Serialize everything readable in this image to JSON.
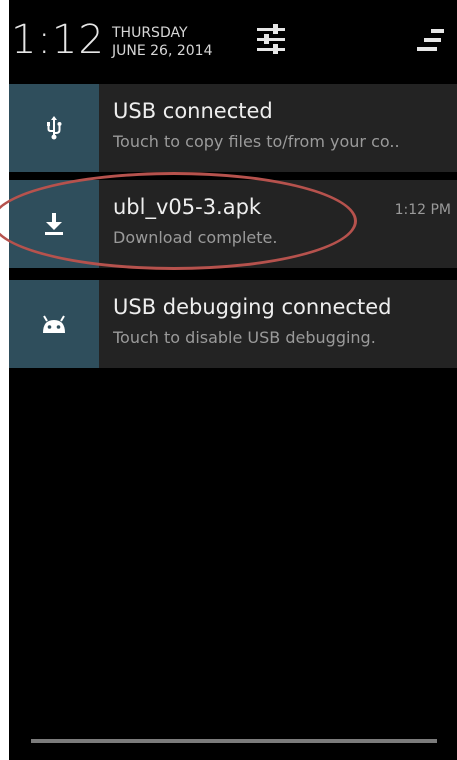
{
  "header": {
    "time": "1:12",
    "day": "THURSDAY",
    "date": "JUNE 26, 2014",
    "settings_icon": "quick-settings-sliders-icon",
    "clear_icon": "clear-all-icon"
  },
  "notifications": [
    {
      "icon": "usb-icon",
      "title": "USB connected",
      "subtitle": "Touch to copy files to/from your co.."
    },
    {
      "icon": "download-complete-icon",
      "title": "ubl_v05-3.apk",
      "subtitle": "Download complete.",
      "time": "1:12 PM"
    },
    {
      "icon": "android-debug-icon",
      "title": "USB debugging connected",
      "subtitle": "Touch to disable USB debugging."
    }
  ],
  "colors": {
    "background": "#000000",
    "notification_bg": "#232323",
    "icon_bg": "#2f4e5c",
    "annotation": "#b6524d"
  }
}
